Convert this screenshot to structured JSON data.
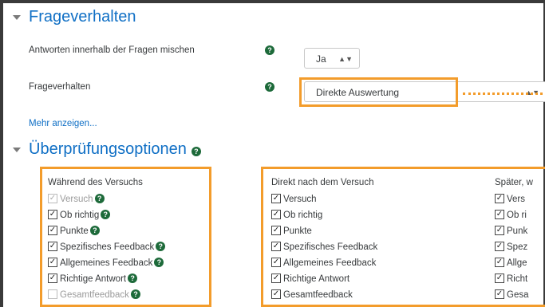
{
  "section1": {
    "title": "Frageverhalten",
    "rows": [
      {
        "label": "Antworten innerhalb der Fragen mischen",
        "value": "Ja"
      },
      {
        "label": "Frageverhalten",
        "value": "Direkte Auswertung"
      }
    ],
    "more_link": "Mehr anzeigen..."
  },
  "section2": {
    "title": "Überprüfungsoptionen",
    "columns": [
      {
        "heading": "Während des Versuchs",
        "items": [
          {
            "label": "Versuch",
            "checked": true,
            "disabled": true,
            "help": true
          },
          {
            "label": "Ob richtig",
            "checked": true,
            "disabled": false,
            "help": true
          },
          {
            "label": "Punkte",
            "checked": true,
            "disabled": false,
            "help": true
          },
          {
            "label": "Spezifisches Feedback",
            "checked": true,
            "disabled": false,
            "help": true
          },
          {
            "label": "Allgemeines Feedback",
            "checked": true,
            "disabled": false,
            "help": true
          },
          {
            "label": "Richtige Antwort",
            "checked": true,
            "disabled": false,
            "help": true
          },
          {
            "label": "Gesamtfeedback",
            "checked": false,
            "disabled": true,
            "help": true
          }
        ]
      },
      {
        "heading": "Direkt nach dem Versuch",
        "items": [
          {
            "label": "Versuch",
            "checked": true
          },
          {
            "label": "Ob richtig",
            "checked": true
          },
          {
            "label": "Punkte",
            "checked": true
          },
          {
            "label": "Spezifisches Feedback",
            "checked": true
          },
          {
            "label": "Allgemeines Feedback",
            "checked": true
          },
          {
            "label": "Richtige Antwort",
            "checked": true
          },
          {
            "label": "Gesamtfeedback",
            "checked": true
          }
        ]
      },
      {
        "heading": "Später, w",
        "items": [
          {
            "label": "Vers",
            "checked": true
          },
          {
            "label": "Ob ri",
            "checked": true
          },
          {
            "label": "Punk",
            "checked": true
          },
          {
            "label": "Spez",
            "checked": true
          },
          {
            "label": "Allge",
            "checked": true
          },
          {
            "label": "Richt",
            "checked": true
          },
          {
            "label": "Gesa",
            "checked": true
          }
        ]
      }
    ]
  },
  "colors": {
    "accent": "#0f6fc5",
    "highlight": "#f39c2b",
    "help": "#1d6a3a"
  }
}
